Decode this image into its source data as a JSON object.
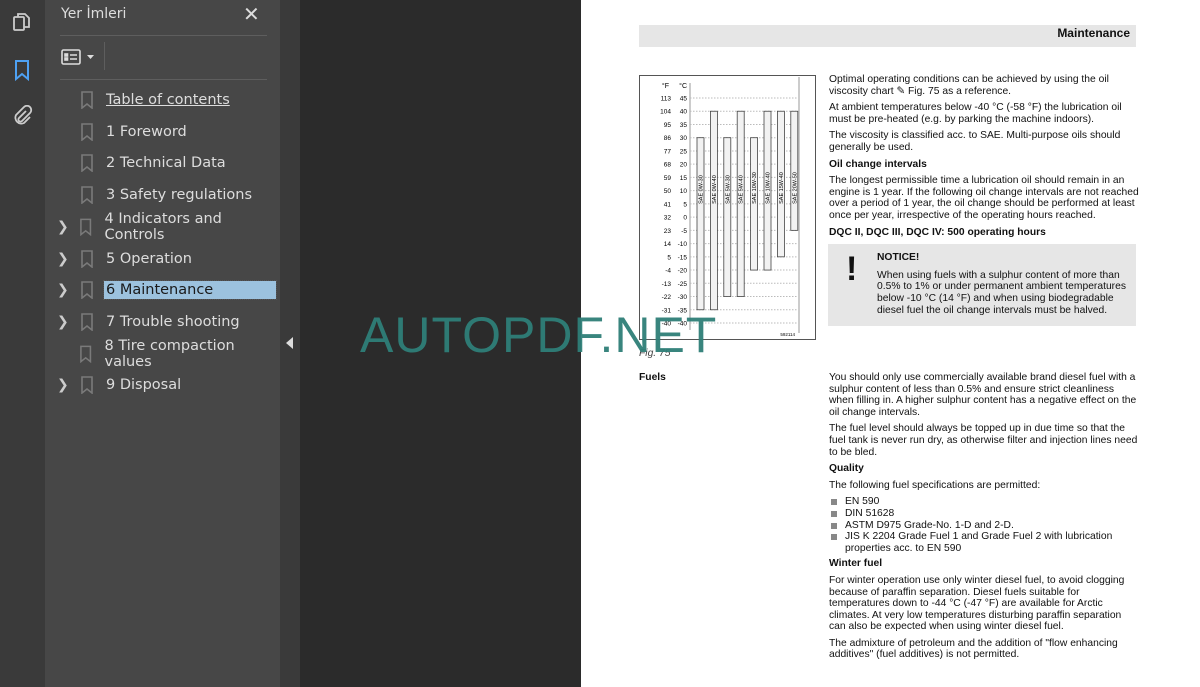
{
  "panel": {
    "title": "Yer İmleri",
    "close": "✕"
  },
  "bookmarks": [
    {
      "label": "Table of contents",
      "expandable": false
    },
    {
      "label": "1 Foreword",
      "expandable": false
    },
    {
      "label": "2 Technical Data",
      "expandable": false
    },
    {
      "label": "3 Safety regulations",
      "expandable": false
    },
    {
      "label": "4 Indicators and Controls",
      "expandable": true
    },
    {
      "label": "5 Operation",
      "expandable": true
    },
    {
      "label": "6 Maintenance",
      "expandable": true,
      "selected": true
    },
    {
      "label": "7 Trouble shooting",
      "expandable": true
    },
    {
      "label": "8 Tire compaction values",
      "expandable": false
    },
    {
      "label": "9 Disposal",
      "expandable": true
    }
  ],
  "colors": {
    "accent": "#4ea1f3",
    "selected": "#9cc2de",
    "watermark": "#2f7f78"
  },
  "watermark": "AUTOPDF.NET",
  "doc": {
    "header": "Maintenance",
    "p1": "Optimal operating conditions can be achieved by using the oil viscosity chart ✎ Fig.  75 as a reference.",
    "p2": "At ambient temperatures below -40 °C (-58 °F) the lubrication oil must be pre-heated (e.g. by parking the machine indoors).",
    "p3": "The viscosity is classified acc. to SAE. Multi-purpose oils should generally be used.",
    "h_oil": "Oil change intervals",
    "p4": "The longest permissible time a lubrication oil should remain in an engine is 1 year. If the following oil change intervals are not reached over a period of 1 year, the oil change should be performed at least once per year, irrespective of the operating hours reached.",
    "h_dqc": "DQC II, DQC III, DQC IV: 500 operating hours",
    "notice_title": "NOTICE!",
    "notice_text": "When using fuels with a sulphur content of more than 0.5% to 1% or under permanent ambient temperatures below -10 °C (14 °F) and when using biodegradable diesel fuel the oil change intervals must be halved.",
    "fig_caption": "Fig.  75",
    "fuels_label": "Fuels",
    "p5": "You should only use commercially available brand diesel fuel with a sulphur content of less than 0.5% and ensure strict cleanliness when filling in. A higher sulphur content has a negative effect on the oil change intervals.",
    "p6": "The fuel level should always be topped up in due time so that the fuel tank is never run dry, as otherwise filter and injection lines need to be bled.",
    "h_quality": "Quality",
    "p7": "The following fuel specifications are permitted:",
    "specs": [
      "EN 590",
      "DIN 51628",
      "ASTM D975 Grade-No. 1-D and 2-D.",
      "JIS K 2204 Grade Fuel 1 and Grade Fuel 2 with lubrication properties acc. to EN 590"
    ],
    "h_winter": "Winter fuel",
    "p8": "For winter operation use only winter diesel fuel, to avoid clogging because of paraffin separation. Diesel fuels suitable for temperatures down to -44 °C (-47 °F) are available for Arctic climates. At very low temperatures disturbing paraffin separation can also be expected when using winter diesel fuel.",
    "p9": "The admixture of petroleum and the addition of \"flow enhancing additives\" (fuel additives) is not permitted."
  },
  "chart_data": {
    "type": "bar",
    "subtype": "range",
    "ylabel_f": "°F",
    "ylabel_c": "°C",
    "ylim": [
      -40,
      45
    ],
    "c_ticks": [
      45,
      40,
      35,
      30,
      25,
      20,
      15,
      10,
      5,
      0,
      -5,
      -10,
      -15,
      -20,
      -25,
      -30,
      -35,
      -40
    ],
    "f_ticks": [
      "113",
      "104",
      "95",
      "86",
      "77",
      "68",
      "59",
      "50",
      "41",
      "32",
      "23",
      "14",
      "5",
      "-4",
      "-13",
      "-22",
      "-31",
      "-40"
    ],
    "grid": true,
    "image_id": "592114",
    "series": [
      {
        "name": "SAE 0W-30",
        "min": -35,
        "max": 30
      },
      {
        "name": "SAE 0W-40",
        "min": -35,
        "max": 40
      },
      {
        "name": "SAE 5W-30",
        "min": -30,
        "max": 30
      },
      {
        "name": "SAE 5W-40",
        "min": -30,
        "max": 40
      },
      {
        "name": "SAE 10W-30",
        "min": -20,
        "max": 30
      },
      {
        "name": "SAE 10W-40",
        "min": -20,
        "max": 40
      },
      {
        "name": "SAE 15W-40",
        "min": -15,
        "max": 40
      },
      {
        "name": "SAE 20W-50",
        "min": -5,
        "max": 40
      }
    ]
  }
}
